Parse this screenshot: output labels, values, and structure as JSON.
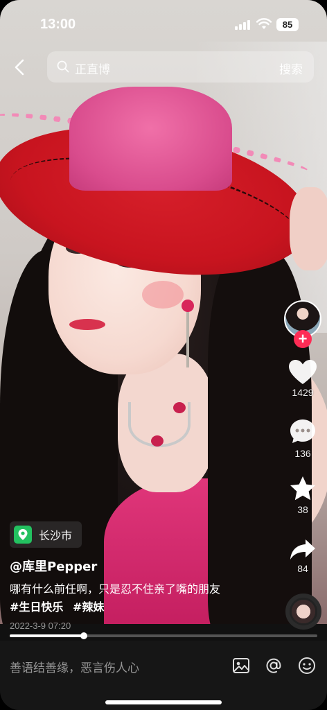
{
  "status_bar": {
    "time": "13:00",
    "battery": "85"
  },
  "search": {
    "placeholder": "正直博",
    "button_label": "搜索"
  },
  "actions": {
    "likes": "1429",
    "comments": "136",
    "favorites": "38",
    "shares": "84",
    "follow_symbol": "+"
  },
  "post": {
    "location": "长沙市",
    "author": "@库里Pepper",
    "caption": "哪有什么前任啊，只是忍不住亲了嘴的朋友",
    "hashtags": [
      "#生日快乐",
      "#辣妹"
    ],
    "date": "2022-3-9 07:20",
    "progress": 0.24
  },
  "comment_bar": {
    "placeholder": "善语结善缘，恶言伤人心"
  },
  "colors": {
    "accent": "#fe2c55",
    "location_green": "#23c160",
    "bottom_bar": "#161616"
  },
  "icons": [
    "back-icon",
    "search-icon",
    "heart-icon",
    "comment-icon",
    "star-icon",
    "share-icon",
    "location-pin-icon",
    "image-icon",
    "at-icon",
    "emoji-icon"
  ]
}
